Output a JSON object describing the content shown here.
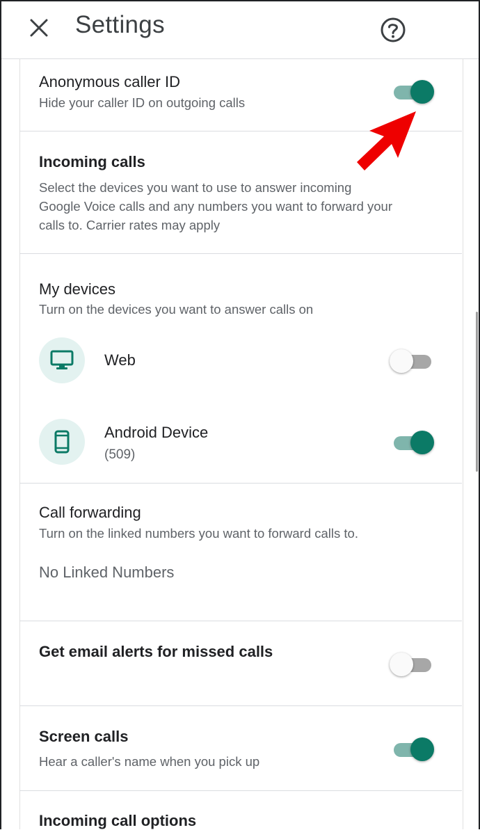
{
  "header": {
    "title": "Settings",
    "close_icon": "close-icon",
    "help_icon": "help-circle-icon"
  },
  "anonymous_caller_id": {
    "title": "Anonymous caller ID",
    "subtitle": "Hide your caller ID on outgoing calls",
    "enabled": true
  },
  "incoming_calls": {
    "title": "Incoming calls",
    "description_lines": [
      "Select the devices you want to use to answer incoming",
      "Google Voice calls and any numbers you want to forward your",
      "calls to. Carrier rates may apply"
    ]
  },
  "my_devices": {
    "title": "My devices",
    "subtitle": "Turn on the devices you want to answer calls on",
    "devices": [
      {
        "name": "Web",
        "detail": "",
        "icon": "monitor-icon",
        "enabled": false
      },
      {
        "name": "Android Device",
        "detail": "(509)",
        "icon": "phone-icon",
        "enabled": true
      }
    ]
  },
  "call_forwarding": {
    "title": "Call forwarding",
    "subtitle": "Turn on the linked numbers you want to forward calls to.",
    "empty_text": "No Linked Numbers"
  },
  "email_alerts": {
    "title": "Get email alerts for missed calls",
    "enabled": false
  },
  "screen_calls": {
    "title": "Screen calls",
    "subtitle": "Hear a caller's name when you pick up",
    "enabled": true
  },
  "incoming_call_options": {
    "title": "Incoming call options"
  },
  "colors": {
    "accent": "#0b7a66",
    "accent_track": "#7fb5ac",
    "annotation_arrow": "#ee0000"
  }
}
